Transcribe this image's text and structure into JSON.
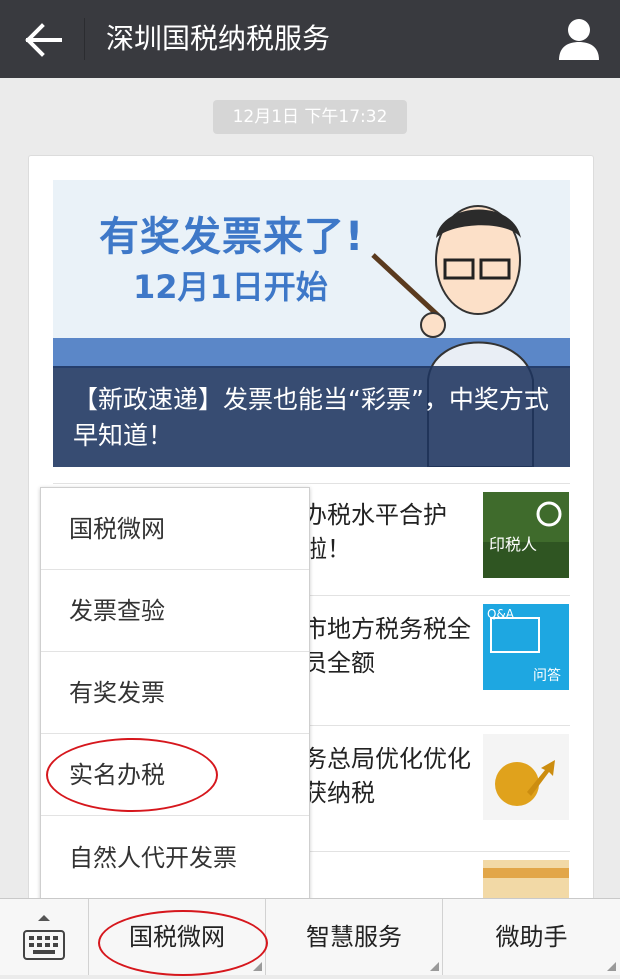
{
  "header": {
    "title": "深圳国税纳税服务"
  },
  "timestamp": "12月1日 下午17:32",
  "banner": {
    "headline": "有奖发票来了!",
    "subhead": "12月1日开始",
    "caption": "【新政速递】发票也能当“彩票”，中奖方式早知道！"
  },
  "articles": [
    {
      "text": "办税水平合护啦！",
      "thumb_text": "印税人"
    },
    {
      "text": "市地方税务税全员全额",
      "thumb_text": "Q&A 问答"
    },
    {
      "text": "务总局优化优化获纳税",
      "thumb_text": ""
    },
    {
      "text": "",
      "thumb_text": ""
    }
  ],
  "menu": {
    "items": [
      "国税微网",
      "发票查验",
      "有奖发票",
      "实名办税",
      "自然人代开发票"
    ]
  },
  "bottom_tabs": [
    "国税微网",
    "智慧服务",
    "微助手"
  ],
  "colors": {
    "topbar": "#393a3f",
    "highlight": "#d6171d",
    "caption_bg": "#1e345e"
  }
}
